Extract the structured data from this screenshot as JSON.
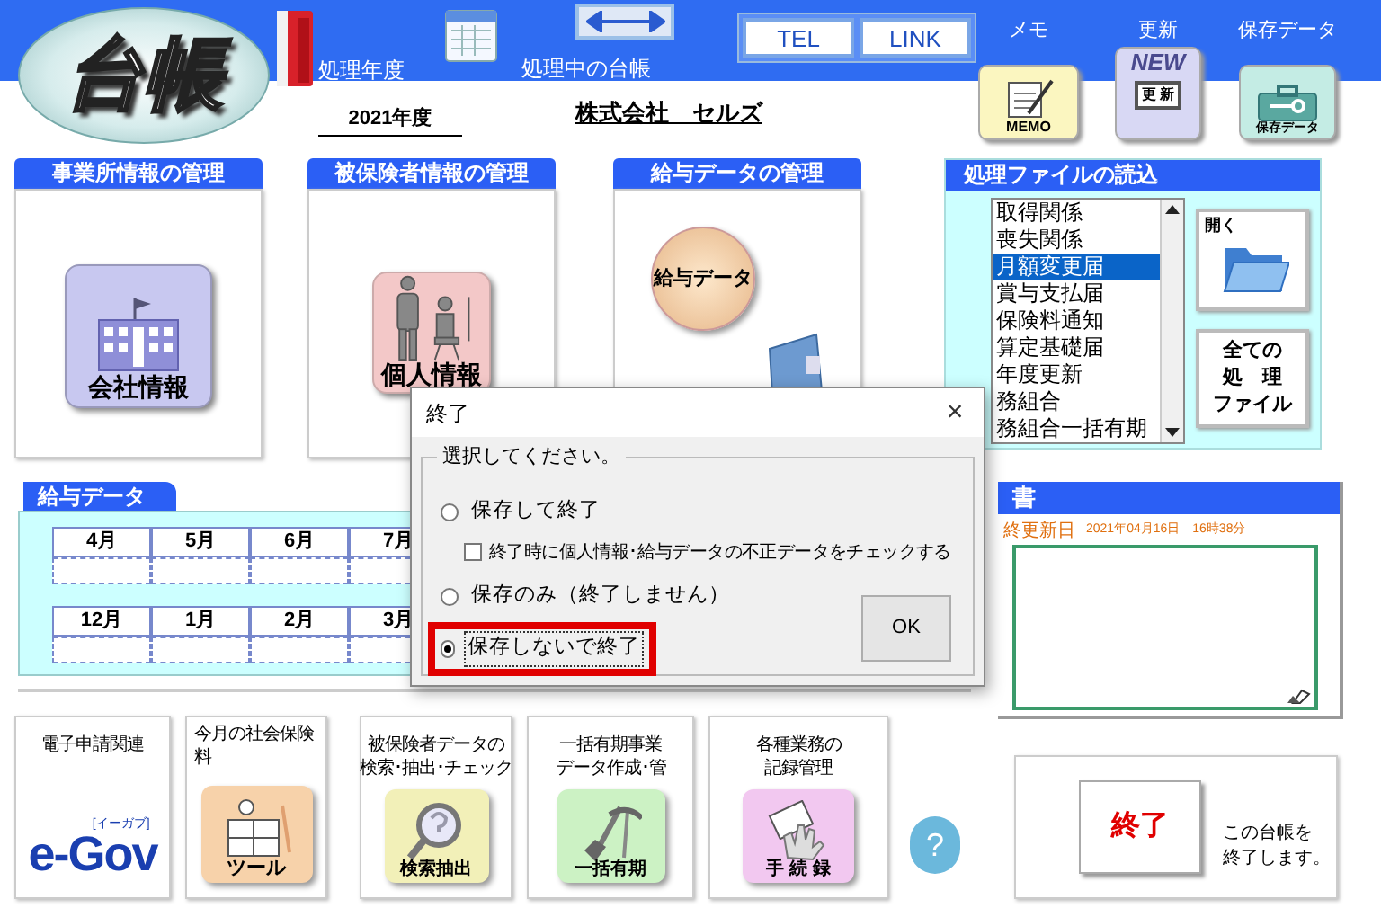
{
  "logo": {
    "text": "台帳"
  },
  "header": {
    "year_label": "処理年度",
    "year": "2021年度",
    "ledger_label": "処理中の台帳",
    "company": "株式会社　セルズ",
    "buttons": [
      "TEL",
      "LINK"
    ],
    "tools": [
      {
        "label": "メモ",
        "kind": "memo",
        "icon_text": "MEMO"
      },
      {
        "label": "更新",
        "kind": "update",
        "icon_text": "更 新",
        "badge": "NEW"
      },
      {
        "label": "保存データ",
        "kind": "save",
        "icon_text": "保存データ"
      }
    ]
  },
  "panels": [
    {
      "title": "事業所情報の管理",
      "kind": "company",
      "icon_text": "会社情報"
    },
    {
      "title": "被保険者情報の管理",
      "kind": "person",
      "icon_text": "個人情報"
    },
    {
      "title": "給与データの管理",
      "kind": "salary",
      "icon_text": "給与データ"
    }
  ],
  "file_loader": {
    "title": "処理ファイルの読込",
    "items": [
      {
        "label": "取得関係",
        "selected": false
      },
      {
        "label": "喪失関係",
        "selected": false
      },
      {
        "label": "月額変更届",
        "selected": true
      },
      {
        "label": "賞与支払届",
        "selected": false
      },
      {
        "label": "保険料通知",
        "selected": false
      },
      {
        "label": "算定基礎届",
        "selected": false
      },
      {
        "label": "年度更新",
        "selected": false
      },
      {
        "label": "務組合",
        "selected": false
      },
      {
        "label": "務組合一括有期",
        "selected": false
      }
    ],
    "open_button": "開く",
    "all_button": [
      "全ての",
      "処　理",
      "ファイル"
    ]
  },
  "salary_data": {
    "title": "給与データ",
    "rows": [
      [
        "4月",
        "5月",
        "6月",
        "7月"
      ],
      [
        "12月",
        "1月",
        "2月",
        "3月"
      ]
    ]
  },
  "notes": {
    "title": "書",
    "updated_label": "終更新日",
    "updated_at": "2021年04月16日　16時38分"
  },
  "shortcuts": [
    {
      "label": [
        "電子申請関連"
      ],
      "kind": "egov",
      "icon_text": "e-Gov",
      "icon_sub": "[イーガブ]"
    },
    {
      "label": [
        "今月の社会保険",
        "料"
      ],
      "kind": "tool",
      "icon_text": "ツール"
    },
    {
      "label": [
        "被保険者データの",
        "検索･抽出･チェック"
      ],
      "kind": "search",
      "icon_text": "検索抽出"
    },
    {
      "label": [
        "一括有期事業",
        "データ作成･管"
      ],
      "kind": "bulk",
      "icon_text": "一括有期"
    },
    {
      "label": [
        "各種業務の",
        "記録管理"
      ],
      "kind": "record",
      "icon_text": "手 続 録"
    }
  ],
  "help": {
    "text": "?"
  },
  "exit_panel": {
    "button": "終了",
    "text": [
      "この台帳を",
      "終了します。"
    ]
  },
  "dialog": {
    "title": "終了",
    "close": "×",
    "group_label": "選択してください。",
    "ok": "OK",
    "options": [
      {
        "kind": "radio",
        "label": "保存して終了",
        "selected": false,
        "highlighted": false
      },
      {
        "kind": "checkbox",
        "label": "終了時に個人情報･給与データの不正データをチェックする",
        "checked": false
      },
      {
        "kind": "radio",
        "label": "保存のみ（終了しません）",
        "selected": false,
        "highlighted": false
      },
      {
        "kind": "radio",
        "label": "保存しないで終了",
        "selected": true,
        "highlighted": true
      }
    ]
  }
}
